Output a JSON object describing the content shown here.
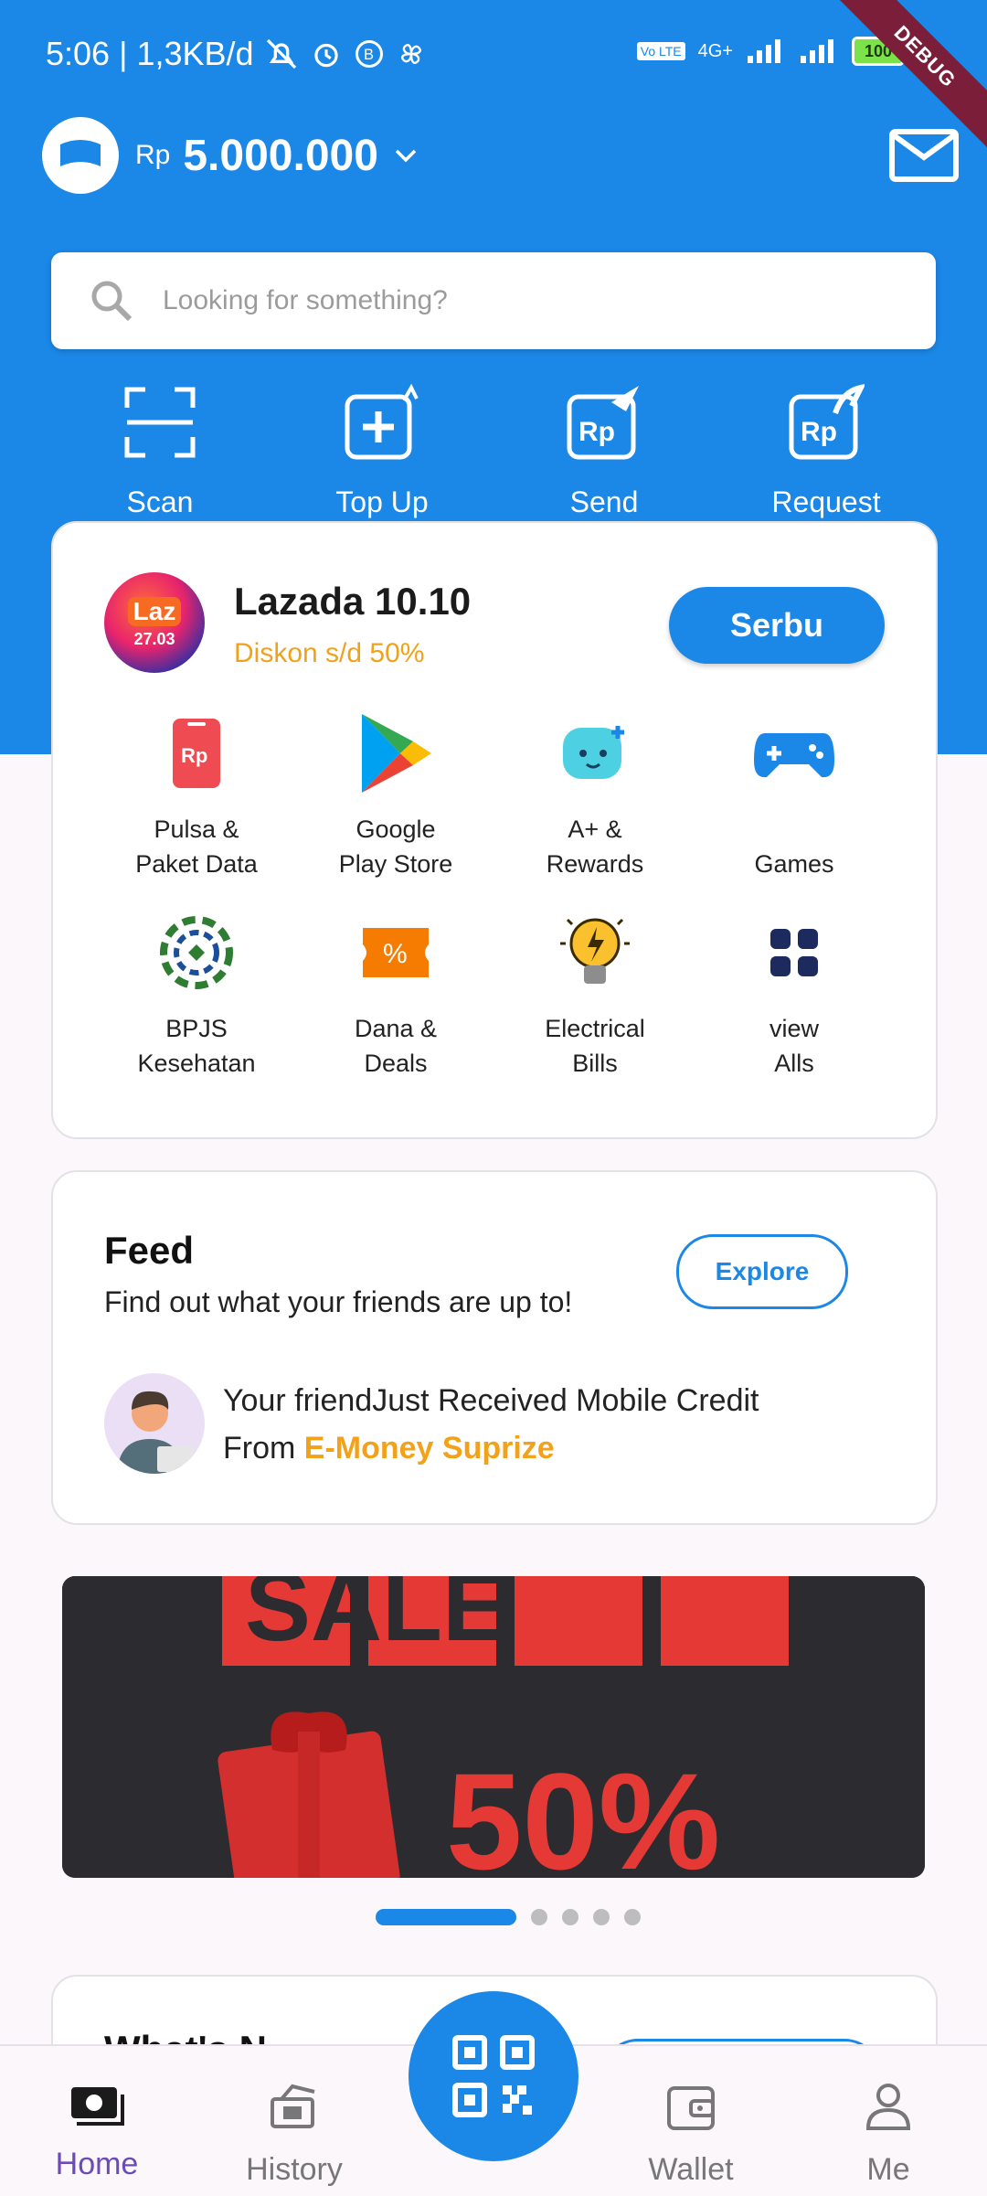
{
  "status_bar": {
    "time": "5:06",
    "network_speed": "1,3KB/d",
    "network_type": "4G+",
    "volte": "Vo LTE",
    "battery": "100",
    "debug_label": "DEBUG"
  },
  "header": {
    "currency": "Rp",
    "balance": "5.000.000"
  },
  "search": {
    "placeholder": "Looking for something?"
  },
  "quick_actions": [
    {
      "label": "Scan",
      "icon": "scan-icon"
    },
    {
      "label": "Top Up",
      "icon": "top-up-icon"
    },
    {
      "label": "Send",
      "icon": "send-icon"
    },
    {
      "label": "Request",
      "icon": "request-icon"
    }
  ],
  "promo": {
    "logo_text": "Laz",
    "logo_date": "27.03",
    "title": "Lazada 10.10",
    "subtitle": "Diskon s/d 50%",
    "button": "Serbu"
  },
  "services": [
    {
      "line1": "Pulsa &",
      "line2": "Paket Data",
      "icon": "phone-credit-icon"
    },
    {
      "line1": "Google",
      "line2": "Play Store",
      "icon": "google-play-icon"
    },
    {
      "line1": "A+ &",
      "line2": "Rewards",
      "icon": "rewards-icon"
    },
    {
      "line1": "",
      "line2": "Games",
      "icon": "gamepad-icon"
    },
    {
      "line1": "BPJS",
      "line2": "Kesehatan",
      "icon": "bpjs-icon"
    },
    {
      "line1": "Dana &",
      "line2": "Deals",
      "icon": "deals-icon"
    },
    {
      "line1": "Electrical",
      "line2": "Bills",
      "icon": "lightbulb-icon"
    },
    {
      "line1": "view",
      "line2": "Alls",
      "icon": "grid-icon"
    }
  ],
  "feed": {
    "title": "Feed",
    "subtitle": "Find out what your friends are up to!",
    "button": "Explore",
    "message_line1": "Your friendJust Received Mobile Credit",
    "message_prefix": "From ",
    "message_highlight": "E-Money Suprize"
  },
  "banner": {
    "text_top": "SALE",
    "text_bottom": "50%",
    "dots_total": 5,
    "active_dot": 1
  },
  "card3": {
    "title_partial": "What's N..."
  },
  "bottom_nav": {
    "home": "Home",
    "history": "History",
    "wallet": "Wallet",
    "me": "Me"
  },
  "colors": {
    "primary": "#1B87E6",
    "accent_orange": "#F2A21A",
    "active_nav": "#6A4BB8"
  }
}
